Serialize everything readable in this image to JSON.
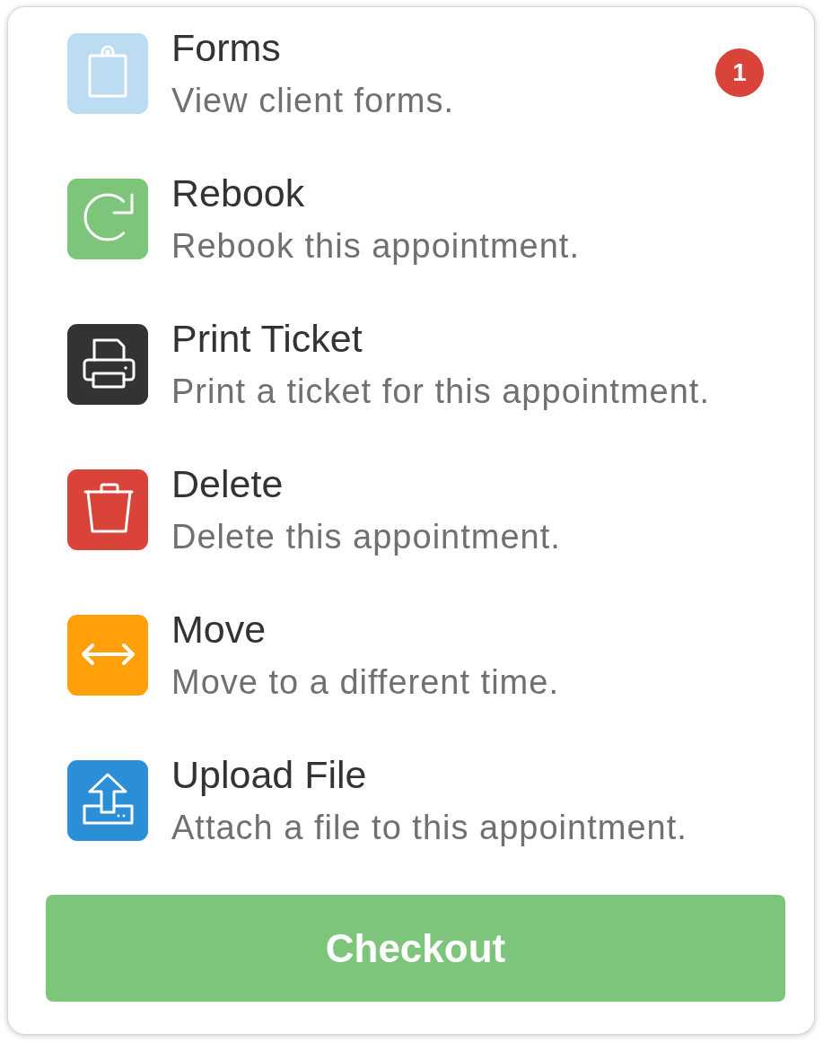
{
  "menu": {
    "items": [
      {
        "title": "Forms",
        "description": "View client forms.",
        "color": "#bcdcf1",
        "badge": "1"
      },
      {
        "title": "Rebook",
        "description": "Rebook this appointment.",
        "color": "#7dc57a"
      },
      {
        "title": "Print Ticket",
        "description": "Print a ticket for this appointment.",
        "color": "#333333"
      },
      {
        "title": "Delete",
        "description": "Delete this appointment.",
        "color": "#d9433a"
      },
      {
        "title": "Move",
        "description": "Move to a different time.",
        "color": "#ffa00a"
      },
      {
        "title": "Upload File",
        "description": "Attach a file to this appointment.",
        "color": "#2a8fd6"
      }
    ]
  },
  "checkout_button": {
    "label": "Checkout"
  }
}
